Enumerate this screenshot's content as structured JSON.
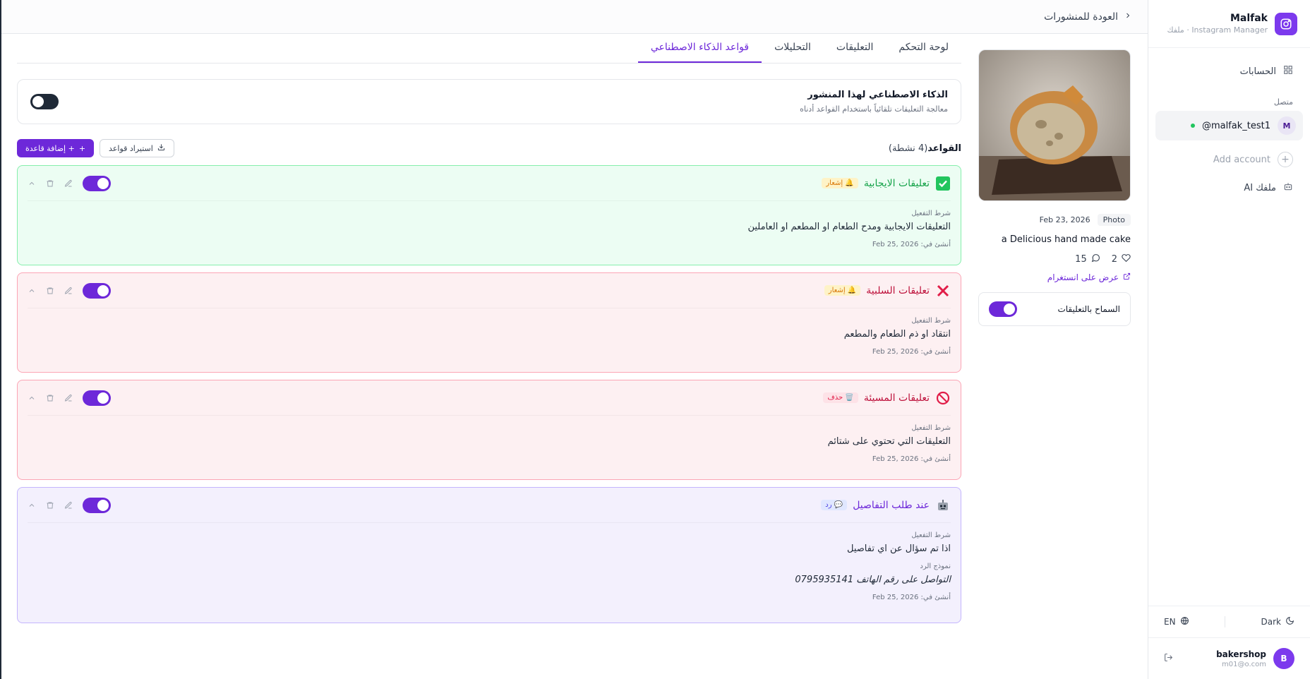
{
  "brand": {
    "name": "Malfak",
    "subtitle": "Instagram Manager · ملفك"
  },
  "sidebar": {
    "accounts_label": "الحسابات",
    "connected_label": "متصل",
    "account": {
      "avatar": "M",
      "handle": "malfak_test1@"
    },
    "add_account": "Add account",
    "ai_profile": "ملفك AI",
    "lang": "EN",
    "theme": "Dark",
    "user": {
      "avatar": "B",
      "name": "bakershop",
      "email": "m01@o.com"
    }
  },
  "topbar": {
    "back_label": "العودة للمنشورات"
  },
  "tabs": [
    "لوحة التحكم",
    "التعليقات",
    "التحليلات",
    "قواعد الذكاء الاصطناعي"
  ],
  "post": {
    "type": "Photo",
    "date": "Feb 23, 2026",
    "caption": "a Delicious hand made cake",
    "likes": "2",
    "comments": "15",
    "ig_link": "عرض على انستغرام",
    "allow_comments": "السماح بالتعليقات"
  },
  "ai_card": {
    "title": "الذكاء الاصطناعي لهذا المنشور",
    "subtitle": "معالجة التعليقات تلقائياً باستخدام القواعد أدناه"
  },
  "rules_header": {
    "title": "القواعد",
    "count": "(4 نشطة)",
    "import_label": "استيراد قواعد",
    "add_label": "+ إضافة قاعدة"
  },
  "rules": [
    {
      "title": "تعليقات الايجابية",
      "badge": "🔔 إشعار",
      "condition_label": "شرط التفعيل",
      "condition": "التعليقات الايجابية ومدح الطعام او المطعم او العاملين",
      "created": "أنشئ في: Feb 25, 2026"
    },
    {
      "title": "تعليقات السلبية",
      "badge": "🔔 إشعار",
      "condition_label": "شرط التفعيل",
      "condition": "انتقاد او ذم الطعام والمطعم",
      "created": "أنشئ في: Feb 25, 2026"
    },
    {
      "title": "تعليقات المسيئة",
      "badge": "🗑️ حذف",
      "condition_label": "شرط التفعيل",
      "condition": "التعليقات التي تحتوي على شتائم",
      "created": "أنشئ في: Feb 25, 2026"
    },
    {
      "title": "عند طلب التفاصيل",
      "badge": "💬 رد",
      "condition_label": "شرط التفعيل",
      "condition": "اذا تم سؤال عن اي تفاصيل",
      "reply_label": "نموذج الرد",
      "reply": "التواصل على رقم الهاتف 0795935141",
      "created": "أنشئ في: Feb 25, 2026"
    }
  ],
  "colors": {
    "accent": "#6d28d9",
    "green": "#16a34a",
    "red": "#be123c"
  }
}
